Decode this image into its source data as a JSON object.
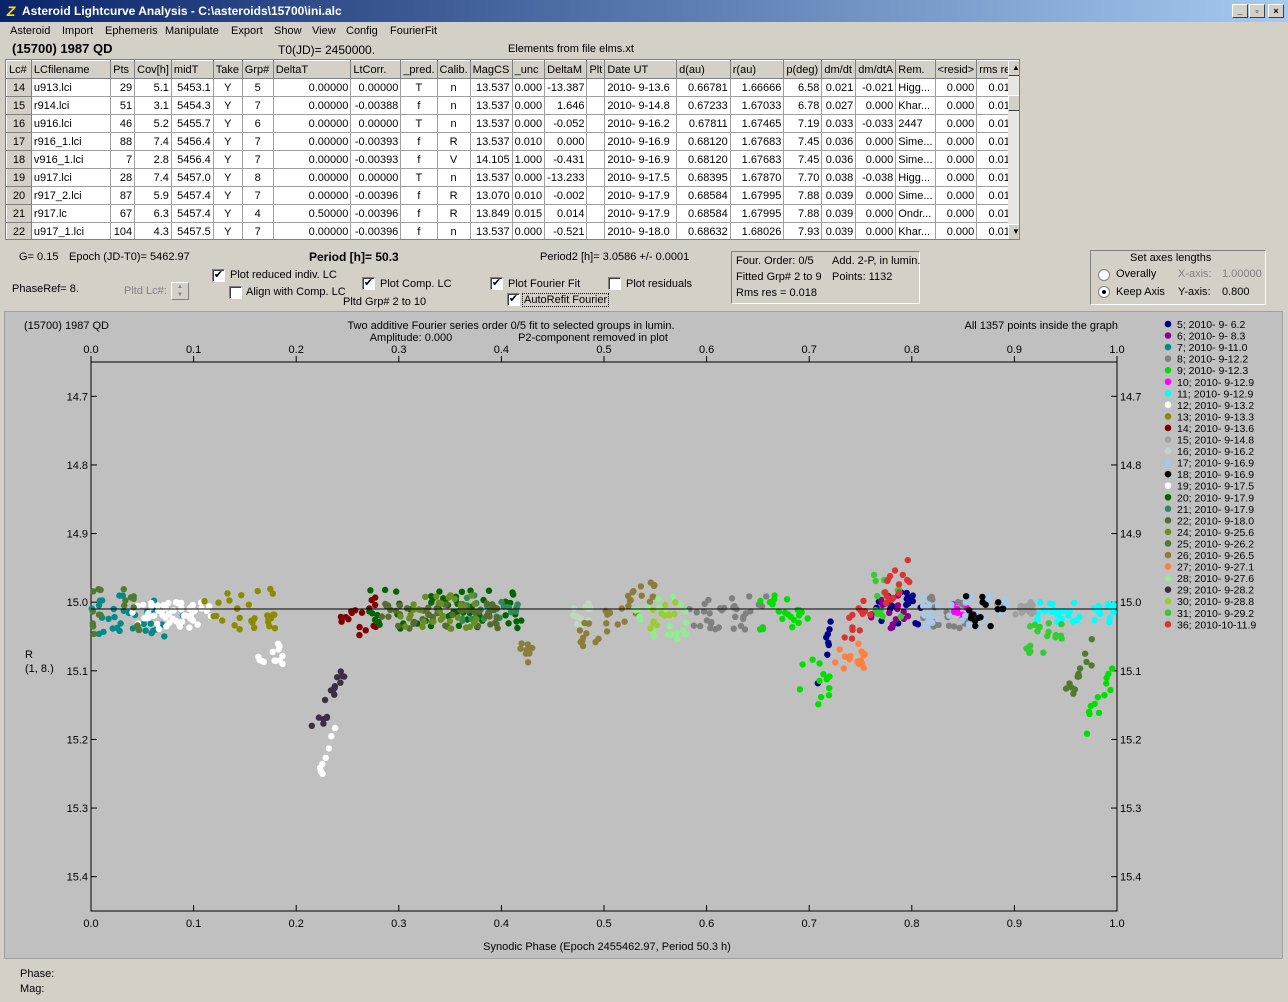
{
  "window": {
    "title": "Asteroid Lightcurve Analysis - C:\\asteroids\\15700\\ini.alc",
    "buttons": [
      "_",
      "▫",
      "×"
    ]
  },
  "menu": [
    "Asteroid",
    "Import",
    "Ephemeris",
    "Manipulate",
    "Export",
    "Show",
    "View",
    "Config",
    "FourierFit"
  ],
  "header": {
    "asteroid": "(15700) 1987 QD",
    "t0": "T0(JD)= 2450000.",
    "elements": "Elements from file elms.xt"
  },
  "table": {
    "columns": [
      "Lc#",
      "LCfilename",
      "Pts",
      "Cov[h]",
      "midT",
      "Take",
      "Grp#",
      "DeltaT",
      "LtCorr.",
      "_pred.",
      "Calib.",
      "MagCS",
      "_unc",
      "DeltaM",
      "Plt",
      "Date UT",
      "d(au)",
      "r(au)",
      "p(deg)",
      "dm/dt",
      "dm/dtA",
      "Rem.",
      "<resid>",
      "rms res"
    ],
    "rows": [
      [
        "14",
        "u913.lci",
        "29",
        "5.1",
        "5453.1",
        "Y",
        "5",
        "0.00000",
        "0.00000",
        "T",
        "n",
        "13.537",
        "0.000",
        "-13.387",
        "",
        "2010- 9-13.6",
        "0.66781",
        "1.66666",
        "6.58",
        "0.021",
        "-0.021",
        "Higg...",
        "0.000",
        "0.019"
      ],
      [
        "15",
        "r914.lci",
        "51",
        "3.1",
        "5454.3",
        "Y",
        "7",
        "0.00000",
        "-0.00388",
        "f",
        "n",
        "13.537",
        "0.000",
        "1.646",
        "",
        "2010- 9-14.8",
        "0.67233",
        "1.67033",
        "6.78",
        "0.027",
        "0.000",
        "Khar...",
        "0.000",
        "0.013"
      ],
      [
        "16",
        "u916.lci",
        "46",
        "5.2",
        "5455.7",
        "Y",
        "6",
        "0.00000",
        "0.00000",
        "T",
        "n",
        "13.537",
        "0.000",
        "-0.052",
        "",
        "2010- 9-16.2",
        "0.67811",
        "1.67465",
        "7.19",
        "0.033",
        "-0.033",
        "2447",
        "0.000",
        "0.019"
      ],
      [
        "17",
        "r916_1.lci",
        "88",
        "7.4",
        "5456.4",
        "Y",
        "7",
        "0.00000",
        "-0.00393",
        "f",
        "R",
        "13.537",
        "0.010",
        "0.000",
        "",
        "2010- 9-16.9",
        "0.68120",
        "1.67683",
        "7.45",
        "0.036",
        "0.000",
        "Sime...",
        "0.000",
        "0.017"
      ],
      [
        "18",
        "v916_1.lci",
        "7",
        "2.8",
        "5456.4",
        "Y",
        "7",
        "0.00000",
        "-0.00393",
        "f",
        "V",
        "14.105",
        "1.000",
        "-0.431",
        "",
        "2010- 9-16.9",
        "0.68120",
        "1.67683",
        "7.45",
        "0.036",
        "0.000",
        "Sime...",
        "0.000",
        "0.014"
      ],
      [
        "19",
        "u917.lci",
        "28",
        "7.4",
        "5457.0",
        "Y",
        "8",
        "0.00000",
        "0.00000",
        "T",
        "n",
        "13.537",
        "0.000",
        "-13.233",
        "",
        "2010- 9-17.5",
        "0.68395",
        "1.67870",
        "7.70",
        "0.038",
        "-0.038",
        "Higg...",
        "0.000",
        "0.019"
      ],
      [
        "20",
        "r917_2.lci",
        "87",
        "5.9",
        "5457.4",
        "Y",
        "7",
        "0.00000",
        "-0.00396",
        "f",
        "R",
        "13.070",
        "0.010",
        "-0.002",
        "",
        "2010- 9-17.9",
        "0.68584",
        "1.67995",
        "7.88",
        "0.039",
        "0.000",
        "Sime...",
        "0.000",
        "0.019"
      ],
      [
        "21",
        "r917.lc",
        "67",
        "6.3",
        "5457.4",
        "Y",
        "4",
        "0.50000",
        "-0.00396",
        "f",
        "R",
        "13.849",
        "0.015",
        "0.014",
        "",
        "2010- 9-17.9",
        "0.68584",
        "1.67995",
        "7.88",
        "0.039",
        "0.000",
        "Ondr...",
        "0.000",
        "0.014"
      ],
      [
        "22",
        "u917_1.lci",
        "104",
        "4.3",
        "5457.5",
        "Y",
        "7",
        "0.00000",
        "-0.00396",
        "f",
        "n",
        "13.537",
        "0.000",
        "-0.521",
        "",
        "2010- 9-18.0",
        "0.68632",
        "1.68026",
        "7.93",
        "0.039",
        "0.000",
        "Khar...",
        "0.000",
        "0.017"
      ]
    ]
  },
  "controls": {
    "g": "G= 0.15",
    "epoch": "Epoch (JD-T0)= 5462.97",
    "period": "Period [h]= 50.3",
    "period2": "Period2 [h]= 3.0586 +/- 0.0001",
    "phaseref": "PhaseRef= 8.",
    "pltd_lc": "Pltd Lc#:",
    "plot_reduced": "Plot reduced indiv. LC",
    "align_comp": "Align with Comp. LC",
    "plot_comp": "Plot Comp. LC",
    "pltd_grp": "Pltd Grp#  2  to  10",
    "plot_fourier": "Plot Fourier Fit",
    "autorefit": "AutoRefit Fourier",
    "plot_residuals": "Plot residuals",
    "four_order": "Four. Order:  0/5",
    "add2p": "Add. 2-P, in lumin.",
    "fitted_grp": "Fitted Grp# 2 to 9",
    "points": "Points: 1132",
    "rms": "Rms res     = 0.018",
    "axes_title": "Set axes lengths",
    "overally": "Overally",
    "keep_axis": "Keep Axis",
    "xaxis_label": "X-axis:",
    "xaxis_val": "1.00000",
    "yaxis_label": "Y-axis:",
    "yaxis_val": "0.800"
  },
  "plot": {
    "corner_title": "(15700) 1987 QD",
    "desc1": "Two additive Fourier series order 0/5 fit to selected groups in lumin.",
    "desc2": "Amplitude: 0.000",
    "desc3": "P2-component removed in plot",
    "points_note": "All 1357 points inside the graph",
    "ylabel1": "R",
    "ylabel2": "(1, 8.)",
    "xlabel": "Synodic Phase (Epoch 2455462.97, Period 50.3 h)",
    "fit_mag": 15.01
  },
  "chart_data": {
    "type": "scatter",
    "xlim": [
      0.0,
      1.0
    ],
    "ylim": [
      15.45,
      14.65
    ],
    "x_ticks": [
      "0.0",
      "0.1",
      "0.2",
      "0.3",
      "0.4",
      "0.5",
      "0.6",
      "0.7",
      "0.8",
      "0.9",
      "1.0"
    ],
    "y_ticks": [
      "14.7",
      "14.8",
      "14.9",
      "15.0",
      "15.1",
      "15.2",
      "15.3",
      "15.4"
    ],
    "series": [
      {
        "name": "5; 2010- 9- 6.2",
        "color": "#00008b",
        "clusters": [
          [
            0.705,
            0.725,
            15.02,
            15.12
          ],
          [
            0.76,
            0.81,
            14.98,
            15.04
          ]
        ]
      },
      {
        "name": "6; 2010- 9- 8.3",
        "color": "#8b008b",
        "clusters": [
          [
            0.76,
            0.8,
            14.99,
            15.04
          ]
        ]
      },
      {
        "name": "7; 2010- 9-11.0",
        "color": "#008b8b",
        "clusters": [
          [
            0.0,
            0.09,
            14.99,
            15.05
          ]
        ]
      },
      {
        "name": "8; 2010- 9-12.2",
        "color": "#808080",
        "clusters": [
          [
            0.58,
            0.66,
            14.99,
            15.04
          ],
          [
            0.81,
            0.86,
            14.99,
            15.04
          ]
        ]
      },
      {
        "name": "9; 2010- 9-12.3",
        "color": "#00e000",
        "clusters": [
          [
            0.65,
            0.7,
            14.99,
            15.04
          ],
          [
            0.69,
            0.72,
            15.08,
            15.15
          ],
          [
            0.97,
            1.0,
            15.1,
            15.18
          ]
        ]
      },
      {
        "name": "10; 2010- 9-12.9",
        "color": "#ff00ff",
        "clusters": [
          [
            0.84,
            0.86,
            15.0,
            15.02
          ]
        ]
      },
      {
        "name": "11; 2010- 9-12.9",
        "color": "#00ffff",
        "clusters": [
          [
            0.91,
            1.0,
            15.0,
            15.03
          ]
        ]
      },
      {
        "name": "12; 2010- 9-13.2",
        "color": "#ffffff",
        "clusters": [
          [
            0.04,
            0.12,
            15.0,
            15.04
          ],
          [
            0.16,
            0.19,
            15.06,
            15.09
          ],
          [
            0.22,
            0.24,
            15.18,
            15.27
          ]
        ]
      },
      {
        "name": "13; 2010- 9-13.3",
        "color": "#8b8b00",
        "clusters": [
          [
            0.11,
            0.18,
            14.98,
            15.04
          ]
        ]
      },
      {
        "name": "14; 2010- 9-13.6",
        "color": "#800000",
        "clusters": [
          [
            0.24,
            0.28,
            14.99,
            15.05
          ]
        ]
      },
      {
        "name": "15; 2010- 9-14.8",
        "color": "#a0a0a0",
        "clusters": [
          [
            0.88,
            0.92,
            15.0,
            15.02
          ]
        ]
      },
      {
        "name": "16; 2010- 9-16.2",
        "color": "#c0d8c0",
        "clusters": [
          [
            0.47,
            0.5,
            15.0,
            15.04
          ]
        ]
      },
      {
        "name": "17; 2010- 9-16.9",
        "color": "#a8c8e8",
        "clusters": [
          [
            0.81,
            0.9,
            14.99,
            15.04
          ]
        ]
      },
      {
        "name": "18; 2010- 9-16.9",
        "color": "#000000",
        "clusters": [
          [
            0.85,
            0.89,
            14.99,
            15.04
          ]
        ]
      },
      {
        "name": "19; 2010- 9-17.5",
        "color": "#ffffff",
        "clusters": [
          [
            0.05,
            0.1,
            15.0,
            15.03
          ]
        ]
      },
      {
        "name": "20; 2010- 9-17.9",
        "color": "#006400",
        "clusters": [
          [
            0.27,
            0.42,
            14.98,
            15.04
          ]
        ]
      },
      {
        "name": "21; 2010- 9-17.9",
        "color": "#2e8b57",
        "clusters": [
          [
            0.36,
            0.42,
            14.99,
            15.03
          ]
        ]
      },
      {
        "name": "22; 2010- 9-18.0",
        "color": "#556b2f",
        "clusters": [
          [
            0.28,
            0.4,
            15.0,
            15.04
          ]
        ]
      },
      {
        "name": "24; 2010- 9-25.6",
        "color": "#6b8e23",
        "clusters": [
          [
            0.3,
            0.38,
            14.99,
            15.04
          ]
        ]
      },
      {
        "name": "25; 2010- 9-26.2",
        "color": "#4f7a2f",
        "clusters": [
          [
            0.0,
            0.05,
            14.98,
            15.05
          ],
          [
            0.95,
            0.98,
            15.06,
            15.14
          ]
        ]
      },
      {
        "name": "26; 2010- 9-26.5",
        "color": "#8b7d3a",
        "clusters": [
          [
            0.47,
            0.55,
            14.98,
            15.06
          ],
          [
            0.41,
            0.43,
            15.06,
            15.1
          ]
        ]
      },
      {
        "name": "27; 2010- 9-27.1",
        "color": "#ff8040",
        "clusters": [
          [
            0.72,
            0.76,
            15.06,
            15.1
          ]
        ]
      },
      {
        "name": "28; 2010- 9-27.6",
        "color": "#90ee90",
        "clusters": [
          [
            0.53,
            0.58,
            14.99,
            15.06
          ]
        ]
      },
      {
        "name": "29; 2010- 9-28.2",
        "color": "#3a2f45",
        "clusters": [
          [
            0.215,
            0.255,
            15.07,
            15.2
          ]
        ]
      },
      {
        "name": "30; 2010- 9-28.8",
        "color": "#9acd32",
        "clusters": [
          [
            0.54,
            0.57,
            15.0,
            15.05
          ]
        ]
      },
      {
        "name": "31; 2010- 9-29.2",
        "color": "#32cd32",
        "clusters": [
          [
            0.76,
            0.79,
            14.96,
            15.03
          ],
          [
            0.91,
            0.95,
            15.03,
            15.08
          ]
        ]
      },
      {
        "name": "36; 2010-10-11.9",
        "color": "#dc3232",
        "clusters": [
          [
            0.73,
            0.8,
            14.95,
            15.05
          ]
        ]
      }
    ]
  },
  "status": {
    "phase": "Phase:",
    "mag": "Mag:"
  }
}
